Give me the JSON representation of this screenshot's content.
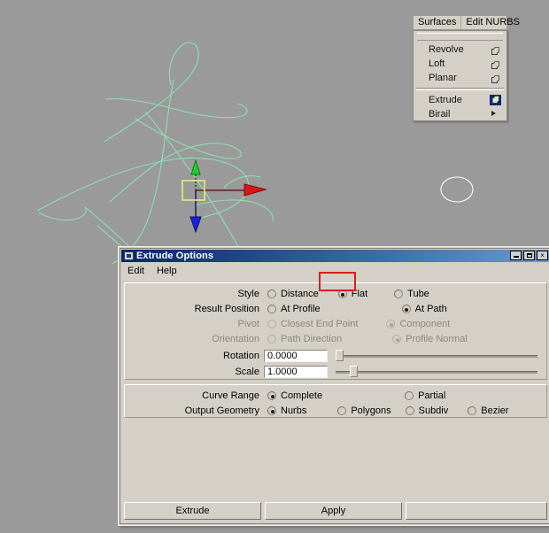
{
  "viewport": {
    "name": "maya-3d-viewport",
    "background_color": "#9a9a9a",
    "curve_color": "#8fe0b8",
    "circle_color": "#ffffff",
    "manipulator": {
      "x_axis_color": "#cc0000",
      "y_axis_color": "#00bb22",
      "z_axis_color": "#1122cc",
      "center_handle_color": "#e8e88a"
    }
  },
  "menu": {
    "tabs": [
      {
        "label": "Surfaces",
        "name": "menu-tab-surfaces"
      },
      {
        "label": "Edit NURBS",
        "name": "menu-tab-edit-nurbs"
      }
    ],
    "items": [
      {
        "label": "Revolve",
        "option_box": true,
        "selected": false,
        "submenu": false
      },
      {
        "label": "Loft",
        "option_box": true,
        "selected": false,
        "submenu": false
      },
      {
        "label": "Planar",
        "option_box": true,
        "selected": false,
        "submenu": false
      },
      {
        "label": "Extrude",
        "option_box": true,
        "selected": true,
        "submenu": false
      },
      {
        "label": "Birail",
        "option_box": false,
        "selected": false,
        "submenu": true
      }
    ]
  },
  "dialog": {
    "title": "Extrude Options",
    "titlebar_buttons": {
      "minimize": "_",
      "maximize": "□",
      "close": "×"
    },
    "menubar": [
      {
        "label": "Edit",
        "name": "dialog-menu-edit"
      },
      {
        "label": "Help",
        "name": "dialog-menu-help"
      }
    ],
    "options": {
      "style": {
        "label": "Style",
        "choices": [
          {
            "label": "Distance",
            "selected": false,
            "disabled": false
          },
          {
            "label": "Flat",
            "selected": true,
            "disabled": false,
            "highlighted": true
          },
          {
            "label": "Tube",
            "selected": false,
            "disabled": false
          }
        ]
      },
      "result_position": {
        "label": "Result Position",
        "choices": [
          {
            "label": "At Profile",
            "selected": false,
            "disabled": false
          },
          {
            "label": "At Path",
            "selected": true,
            "disabled": false
          }
        ]
      },
      "pivot": {
        "label": "Pivot",
        "disabled": true,
        "choices": [
          {
            "label": "Closest End Point",
            "selected": false,
            "disabled": true
          },
          {
            "label": "Component",
            "selected": true,
            "disabled": true
          }
        ]
      },
      "orientation": {
        "label": "Orientation",
        "disabled": true,
        "choices": [
          {
            "label": "Path Direction",
            "selected": false,
            "disabled": true
          },
          {
            "label": "Profile Normal",
            "selected": true,
            "disabled": true
          }
        ]
      },
      "rotation": {
        "label": "Rotation",
        "value": "0.0000",
        "slider_percent": 1
      },
      "scale": {
        "label": "Scale",
        "value": "1.0000",
        "slider_percent": 11
      },
      "curve_range": {
        "label": "Curve Range",
        "choices": [
          {
            "label": "Complete",
            "selected": true
          },
          {
            "label": "Partial",
            "selected": false
          }
        ]
      },
      "output_geometry": {
        "label": "Output Geometry",
        "choices": [
          {
            "label": "Nurbs",
            "selected": true
          },
          {
            "label": "Polygons",
            "selected": false
          },
          {
            "label": "Subdiv",
            "selected": false
          },
          {
            "label": "Bezier",
            "selected": false
          }
        ]
      }
    },
    "buttons": [
      {
        "label": "Extrude",
        "name": "extrude-button"
      },
      {
        "label": "Apply",
        "name": "apply-button"
      }
    ],
    "highlight_color": "#e01b1b"
  }
}
